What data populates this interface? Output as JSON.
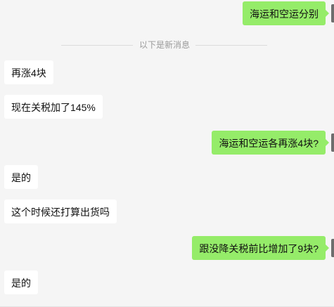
{
  "divider": {
    "text": "以下是新消息"
  },
  "messages": [
    {
      "sender": "self",
      "text": "海运和空运分别"
    },
    {
      "sender": "other",
      "text": "再涨4块"
    },
    {
      "sender": "other",
      "text": "现在关税加了145%"
    },
    {
      "sender": "self",
      "text": "海运和空运各再涨4块?"
    },
    {
      "sender": "other",
      "text": "是的"
    },
    {
      "sender": "other",
      "text": "这个时候还打算出货吗"
    },
    {
      "sender": "self",
      "text": "跟没降关税前比增加了9块?"
    },
    {
      "sender": "other",
      "text": "是的"
    }
  ],
  "colors": {
    "background": "#f5f5f5",
    "self_bubble": "#95ec69",
    "other_bubble": "#ffffff",
    "divider_text": "#9a9a9a"
  }
}
